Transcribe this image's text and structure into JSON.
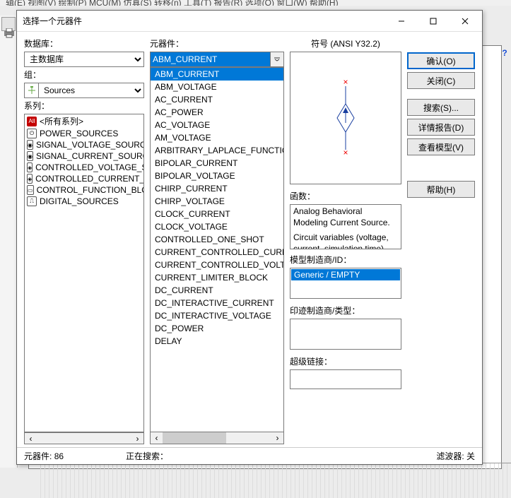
{
  "window": {
    "title": "选择一个元器件",
    "minimize_tip": "最小化",
    "maximize_tip": "最大化",
    "close_tip": "关闭"
  },
  "backdrop_menubar": "辑(E)  视图(V)  绘制(P)  MCU(M)  仿真(S)  转移(n)  工具(T)  报告(R)  选项(O)  窗口(W)  帮助(H)",
  "left": {
    "database_label": "数据库：",
    "database_value": "主数据库",
    "group_label": "组：",
    "group_value": "Sources",
    "series_label": "系列：",
    "series": [
      {
        "icon": "All",
        "label": "<所有系列>",
        "selected": true
      },
      {
        "icon": "⏻",
        "label": "POWER_SOURCES"
      },
      {
        "icon": "◉",
        "label": "SIGNAL_VOLTAGE_SOURCES"
      },
      {
        "icon": "◉",
        "label": "SIGNAL_CURRENT_SOURCES"
      },
      {
        "icon": "◈",
        "label": "CONTROLLED_VOLTAGE_SOURCES"
      },
      {
        "icon": "◈",
        "label": "CONTROLLED_CURRENT_SOURCES"
      },
      {
        "icon": "▭",
        "label": "CONTROL_FUNCTION_BLOCKS"
      },
      {
        "icon": "⎍",
        "label": "DIGITAL_SOURCES"
      }
    ]
  },
  "mid": {
    "component_label": "元器件：",
    "component_value": "ABM_CURRENT",
    "components": [
      "ABM_CURRENT",
      "ABM_VOLTAGE",
      "AC_CURRENT",
      "AC_POWER",
      "AC_VOLTAGE",
      "AM_VOLTAGE",
      "ARBITRARY_LAPLACE_FUNCTION",
      "BIPOLAR_CURRENT",
      "BIPOLAR_VOLTAGE",
      "CHIRP_CURRENT",
      "CHIRP_VOLTAGE",
      "CLOCK_CURRENT",
      "CLOCK_VOLTAGE",
      "CONTROLLED_ONE_SHOT",
      "CURRENT_CONTROLLED_CURRENT_SOURCE",
      "CURRENT_CONTROLLED_VOLTAGE_SOURCE",
      "CURRENT_LIMITER_BLOCK",
      "DC_CURRENT",
      "DC_INTERACTIVE_CURRENT",
      "DC_INTERACTIVE_VOLTAGE",
      "DC_POWER",
      "DELAY"
    ],
    "selected_index": 0
  },
  "right": {
    "symbol_label": "符号 (ANSI Y32.2)",
    "function_label": "函数：",
    "function_text_1": "Analog Behavioral Modeling Current Source.",
    "function_text_2": "Circuit variables (voltage, current, simulation time) along with various",
    "model_label": "模型制造商/ID：",
    "model_value": "Generic / EMPTY",
    "footprint_label": "印迹制造商/类型：",
    "hyperlink_label": "超级链接："
  },
  "buttons": {
    "ok": "确认(O)",
    "close": "关闭(C)",
    "search": "搜索(S)...",
    "detail": "详情报告(D)",
    "model": "查看模型(V)",
    "help": "帮助(H)"
  },
  "status": {
    "count_label": "元器件:",
    "count_value": "86",
    "searching_label": "正在搜索：",
    "filter_label": "滤波器: 关"
  }
}
